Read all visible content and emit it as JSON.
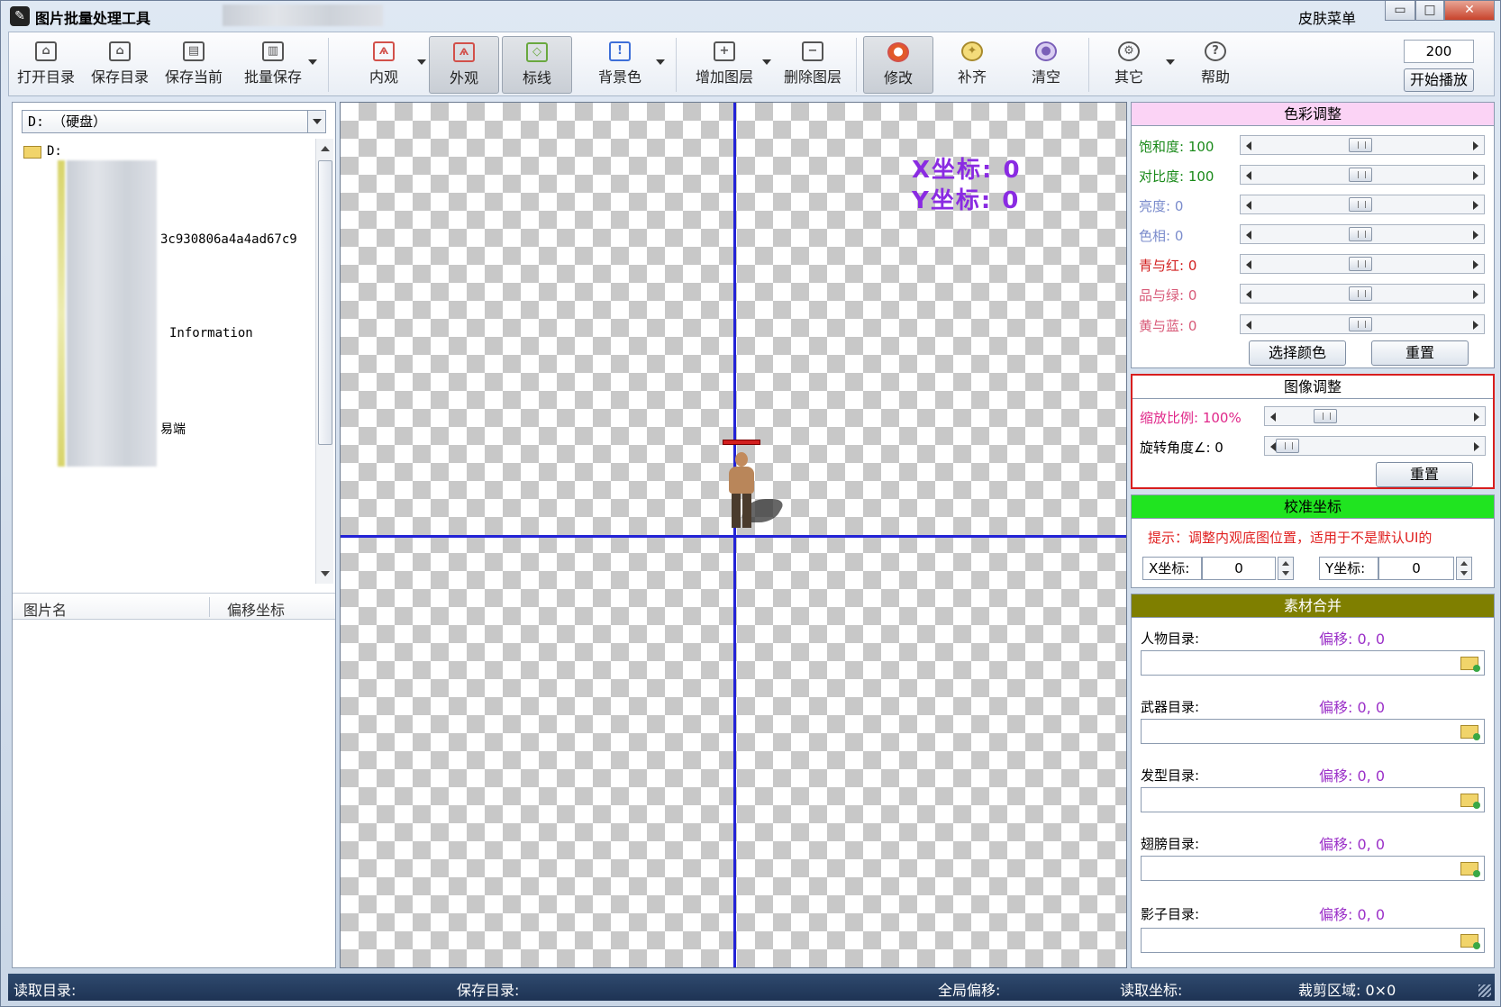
{
  "window": {
    "title": "图片批量处理工具",
    "skin_menu": "皮肤菜单",
    "controls": {
      "minimize": "▭",
      "maximize": "□",
      "close": "✕"
    }
  },
  "toolbar": {
    "open_dir": "打开目录",
    "save_dir": "保存目录",
    "save_current": "保存当前",
    "batch_save": "批量保存",
    "inner": "内观",
    "outer": "外观",
    "guide": "标线",
    "bg_color": "背景色",
    "add_layer": "增加图层",
    "delete_layer": "删除图层",
    "modify": "修改",
    "fill": "补齐",
    "clear": "清空",
    "other": "其它",
    "help": "帮助",
    "play_interval": "200",
    "start_play": "开始播放"
  },
  "left_panel": {
    "drive": "D: （硬盘）",
    "tree_root": "D:",
    "tree_items": [
      "3c930806a4a4ad67c9",
      "Information",
      "易端"
    ],
    "list_columns": [
      "图片名",
      "偏移坐标"
    ]
  },
  "canvas": {
    "x_coord": "X坐标: 0",
    "y_coord": "Y坐标: 0"
  },
  "color_adjust": {
    "title": "色彩调整",
    "saturation": "饱和度: 100",
    "contrast": "对比度: 100",
    "brightness": "亮度: 0",
    "hue": "色相: 0",
    "cyan_red": "青与红: 0",
    "magenta_green": "品与绿: 0",
    "yellow_blue": "黄与蓝: 0",
    "choose_color": "选择颜色",
    "reset": "重置"
  },
  "image_adjust": {
    "title": "图像调整",
    "scale": "缩放比例: 100%",
    "rotate": "旋转角度∠: 0",
    "reset": "重置"
  },
  "calibrate": {
    "title": "校准坐标",
    "hint": "提示：调整内观底图位置，适用于不是默认UI的",
    "x_label": "X坐标:",
    "x_value": "0",
    "y_label": "Y坐标:",
    "y_value": "0"
  },
  "merge": {
    "title": "素材合并",
    "rows": [
      {
        "label": "人物目录:",
        "offset": "偏移: 0, 0"
      },
      {
        "label": "武器目录:",
        "offset": "偏移: 0, 0"
      },
      {
        "label": "发型目录:",
        "offset": "偏移: 0, 0"
      },
      {
        "label": "翅膀目录:",
        "offset": "偏移: 0, 0"
      },
      {
        "label": "影子目录:",
        "offset": "偏移: 0, 0"
      }
    ]
  },
  "status": {
    "read_dir": "读取目录:",
    "save_dir": "保存目录:",
    "global_offset": "全局偏移:",
    "read_coord": "读取坐标:",
    "crop_area": "裁剪区域: 0×0"
  },
  "colors": {
    "saturation_label": "#1a8a1a",
    "muted_label": "#7b8ccc",
    "red_label": "#d21f1f",
    "pink_label": "#d85a78",
    "scale_label": "#e0288a",
    "coord_text": "#8a2be2",
    "guide_line": "#2323d6",
    "color_header": "#fbd3f5",
    "calibrate_header": "#20e420",
    "merge_header": "#7f7f00",
    "hint_text": "#e02020",
    "offset_text": "#9b30c8"
  }
}
